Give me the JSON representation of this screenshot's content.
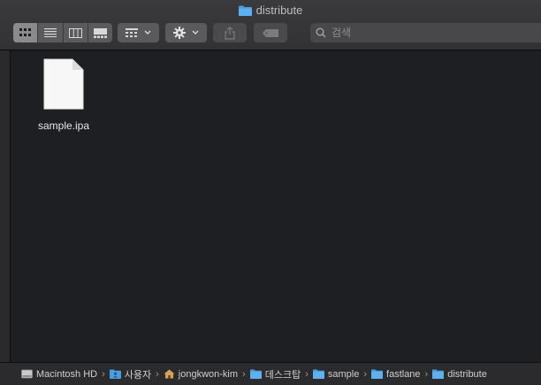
{
  "window": {
    "title": "distribute"
  },
  "toolbar": {
    "view_modes": [
      {
        "name": "icon-view",
        "icon": "grid-icon",
        "active": true
      },
      {
        "name": "list-view",
        "icon": "list-icon",
        "active": false
      },
      {
        "name": "column-view",
        "icon": "columns-icon",
        "active": false
      },
      {
        "name": "gallery-view",
        "icon": "gallery-icon",
        "active": false
      }
    ],
    "group_icon": "group-grid-icon",
    "action_icon": "gear-icon",
    "share_icon": "share-icon",
    "tag_icon": "tag-icon"
  },
  "search": {
    "placeholder": "검색",
    "value": ""
  },
  "files": [
    {
      "name": "sample.ipa",
      "icon": "document-icon"
    }
  ],
  "pathbar": {
    "items": [
      {
        "label": "Macintosh HD",
        "icon": "hard-drive-icon"
      },
      {
        "label": "사용자",
        "icon": "users-folder-icon"
      },
      {
        "label": "jongkwon-kim",
        "icon": "home-icon"
      },
      {
        "label": "데스크탑",
        "icon": "folder-icon"
      },
      {
        "label": "sample",
        "icon": "folder-icon"
      },
      {
        "label": "fastlane",
        "icon": "folder-icon"
      },
      {
        "label": "distribute",
        "icon": "folder-icon"
      }
    ]
  },
  "colors": {
    "folder_blue": "#4a9ee0",
    "background": "#1e1f22"
  }
}
